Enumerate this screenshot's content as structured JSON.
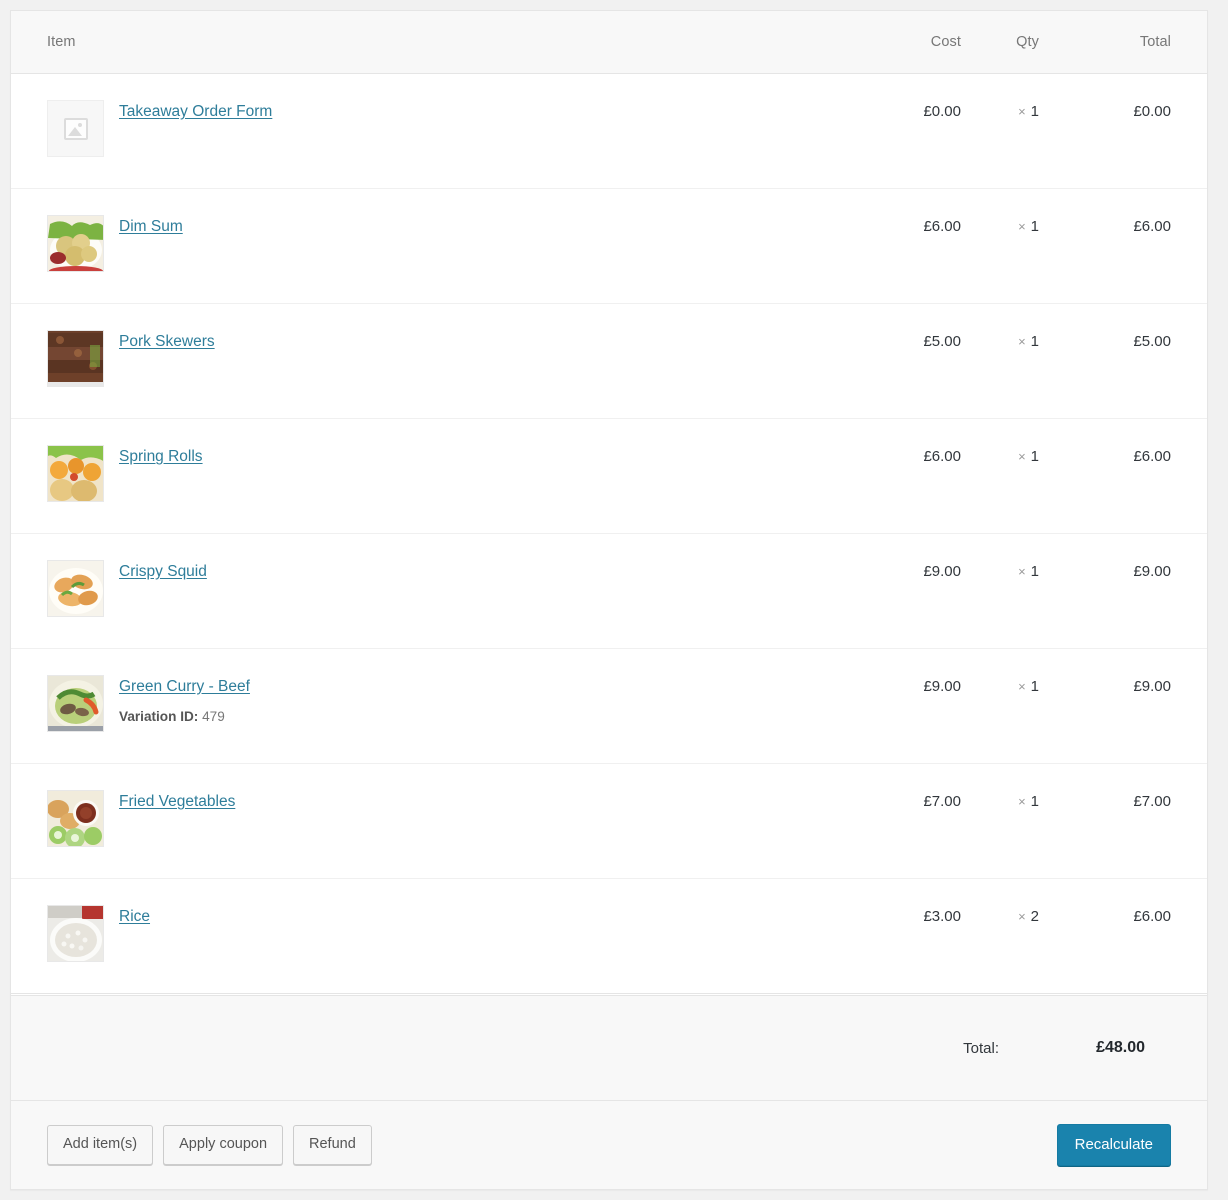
{
  "table": {
    "headers": {
      "item": "Item",
      "cost": "Cost",
      "qty": "Qty",
      "total": "Total"
    },
    "rows": [
      {
        "name": "Takeaway Order Form",
        "thumb": "placeholder-image-icon",
        "cost": "£0.00",
        "qty_symbol": "×",
        "qty": "1",
        "total": "£0.00",
        "meta": null
      },
      {
        "name": "Dim Sum",
        "thumb": "dim-sum-photo",
        "cost": "£6.00",
        "qty_symbol": "×",
        "qty": "1",
        "total": "£6.00",
        "meta": null
      },
      {
        "name": "Pork Skewers",
        "thumb": "pork-skewers-photo",
        "cost": "£5.00",
        "qty_symbol": "×",
        "qty": "1",
        "total": "£5.00",
        "meta": null
      },
      {
        "name": "Spring Rolls",
        "thumb": "spring-rolls-photo",
        "cost": "£6.00",
        "qty_symbol": "×",
        "qty": "1",
        "total": "£6.00",
        "meta": null
      },
      {
        "name": "Crispy Squid",
        "thumb": "crispy-squid-photo",
        "cost": "£9.00",
        "qty_symbol": "×",
        "qty": "1",
        "total": "£9.00",
        "meta": null
      },
      {
        "name": "Green Curry - Beef",
        "thumb": "green-curry-photo",
        "cost": "£9.00",
        "qty_symbol": "×",
        "qty": "1",
        "total": "£9.00",
        "meta": {
          "label": "Variation ID:",
          "value": "479"
        }
      },
      {
        "name": "Fried Vegetables",
        "thumb": "fried-vegetables-photo",
        "cost": "£7.00",
        "qty_symbol": "×",
        "qty": "1",
        "total": "£7.00",
        "meta": null
      },
      {
        "name": "Rice",
        "thumb": "rice-photo",
        "cost": "£3.00",
        "qty_symbol": "×",
        "qty": "2",
        "total": "£6.00",
        "meta": null
      }
    ]
  },
  "totals": {
    "label": "Total:",
    "value": "£48.00"
  },
  "footer": {
    "add_items_label": "Add item(s)",
    "apply_coupon_label": "Apply coupon",
    "refund_label": "Refund",
    "recalculate_label": "Recalculate"
  },
  "colors": {
    "link": "#2e7d9a",
    "primary_button": "#1a83ad",
    "panel_background": "#ffffff",
    "page_background": "#f1f1f1",
    "header_background": "#f8f8f8",
    "muted_text": "#777777"
  }
}
